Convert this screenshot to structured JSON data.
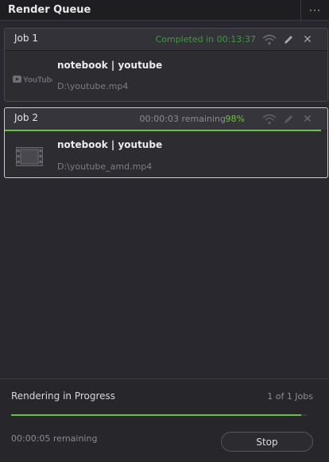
{
  "panel": {
    "title": "Render Queue",
    "more_icon": "more-dots-icon"
  },
  "jobs": [
    {
      "name": "Job 1",
      "status": "Completed in 00:13:37",
      "status_color": "#3f9a3f",
      "clip_name": "notebook | youtube",
      "path": "D:\\youtube.mp4",
      "thumbnail": "YouTube",
      "thumbnail_icon": "youtube-logo-icon",
      "selected": false
    },
    {
      "name": "Job 2",
      "remaining": "00:00:03 remaining",
      "percent": "98%",
      "progress": 0.98,
      "clip_name": "notebook | youtube",
      "path": "D:\\youtube_amd.mp4",
      "thumbnail_icon": "film-clip-icon",
      "selected": true
    }
  ],
  "footer": {
    "status": "Rendering in Progress",
    "count": "1 of 1 Jobs",
    "progress": 0.98,
    "remaining": "00:00:05 remaining",
    "stop_label": "Stop"
  },
  "colors": {
    "accent_green": "#6cc23a",
    "completed_green": "#3f9a3f",
    "background": "#28282e"
  }
}
